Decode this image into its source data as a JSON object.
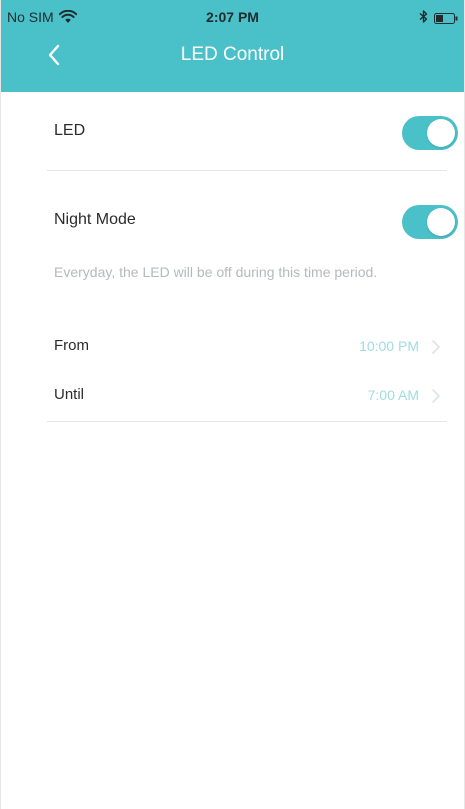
{
  "status_bar": {
    "carrier": "No SIM",
    "time": "2:07 PM",
    "icons": [
      "wifi-icon",
      "bluetooth-icon",
      "battery-icon"
    ]
  },
  "nav": {
    "title": "LED Control",
    "back_icon": "chevron-left-icon"
  },
  "settings": {
    "led": {
      "label": "LED",
      "enabled": true
    },
    "night_mode": {
      "label": "Night Mode",
      "enabled": true,
      "description": "Everyday, the LED will be off during this time period."
    },
    "from": {
      "label": "From",
      "value": "10:00 PM"
    },
    "until": {
      "label": "Until",
      "value": "7:00 AM"
    }
  },
  "colors": {
    "accent": "#4ac0c9",
    "time_value": "#9fdde2",
    "description": "#b5b9bc"
  }
}
